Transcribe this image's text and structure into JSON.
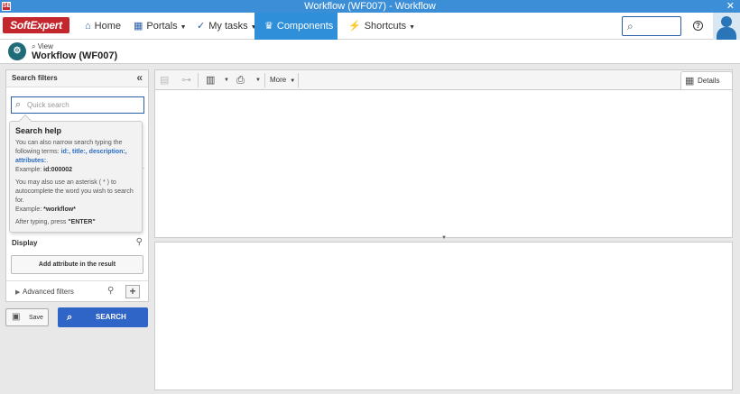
{
  "window": {
    "title": "Workflow (WF007) - Workflow",
    "close": "✕"
  },
  "nav": {
    "logo": "SoftExpert",
    "items": [
      {
        "label": "Home",
        "icon": "home-icon"
      },
      {
        "label": "Portals",
        "icon": "grid-icon"
      },
      {
        "label": "My tasks",
        "icon": "check-icon"
      },
      {
        "label": "Components",
        "icon": "trophy-icon"
      },
      {
        "label": "Shortcuts",
        "icon": "lightning-icon"
      }
    ],
    "active_color": "#2f8fd8"
  },
  "page": {
    "breadcrumb": "View",
    "title": "Workflow (WF007)"
  },
  "filters": {
    "heading": "Search filters",
    "quick_search_placeholder": "Quick search",
    "display_label": "Display",
    "add_attribute": "Add attribute in the result",
    "advanced_filters": "Advanced filters"
  },
  "help": {
    "title": "Search help",
    "line1": "You can also narrow search typing the following terms: ",
    "terms": "id:, title:, description:, attributes:",
    "line1_end": ".",
    "example1_label": "Example: ",
    "example1": "id:000002",
    "line2": "You may also use an asterisk ( * ) to autocomplete the word you wish to search for.",
    "example2_label": "Example: ",
    "example2": "*workflow*",
    "line3_pre": "After typing, press ",
    "line3_key": "\"ENTER\""
  },
  "actions": {
    "save": "Save",
    "search": "SEARCH",
    "search_color": "#3065c8"
  },
  "toolbar": {
    "more": "More",
    "details": "Details"
  }
}
